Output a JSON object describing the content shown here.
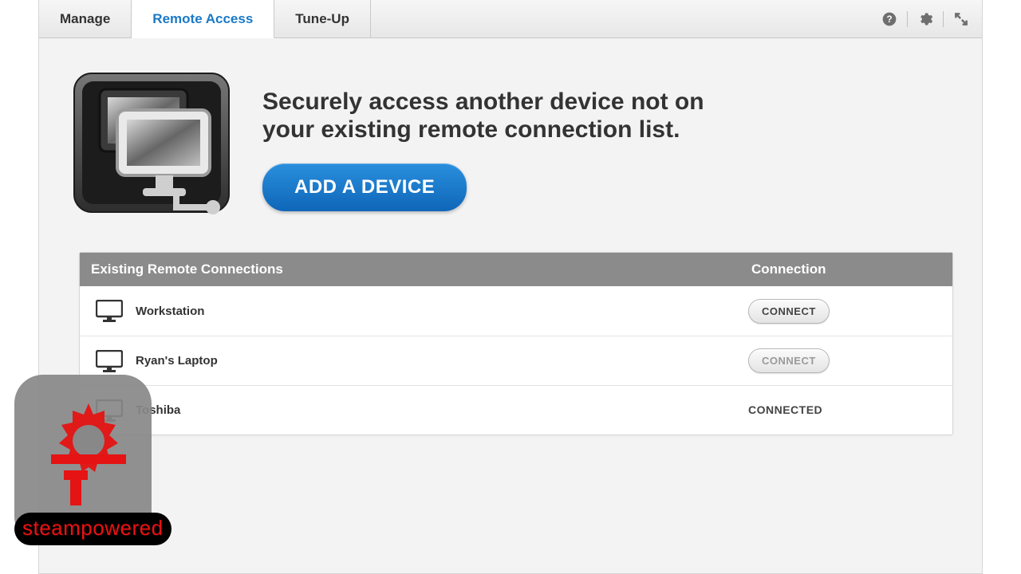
{
  "tabs": [
    {
      "label": "Manage",
      "active": false
    },
    {
      "label": "Remote Access",
      "active": true
    },
    {
      "label": "Tune-Up",
      "active": false
    }
  ],
  "headline": "Securely access another device not on your existing remote connection list.",
  "add_button": "ADD A DEVICE",
  "table": {
    "col_name": "Existing Remote Connections",
    "col_conn": "Connection",
    "rows": [
      {
        "name": "Workstation",
        "state": "button",
        "button_label": "CONNECT"
      },
      {
        "name": "Ryan's Laptop",
        "state": "button-disabled",
        "button_label": "CONNECT"
      },
      {
        "name": "Toshiba",
        "state": "text",
        "status_text": "CONNECTED"
      }
    ]
  },
  "watermark": "steampowered"
}
